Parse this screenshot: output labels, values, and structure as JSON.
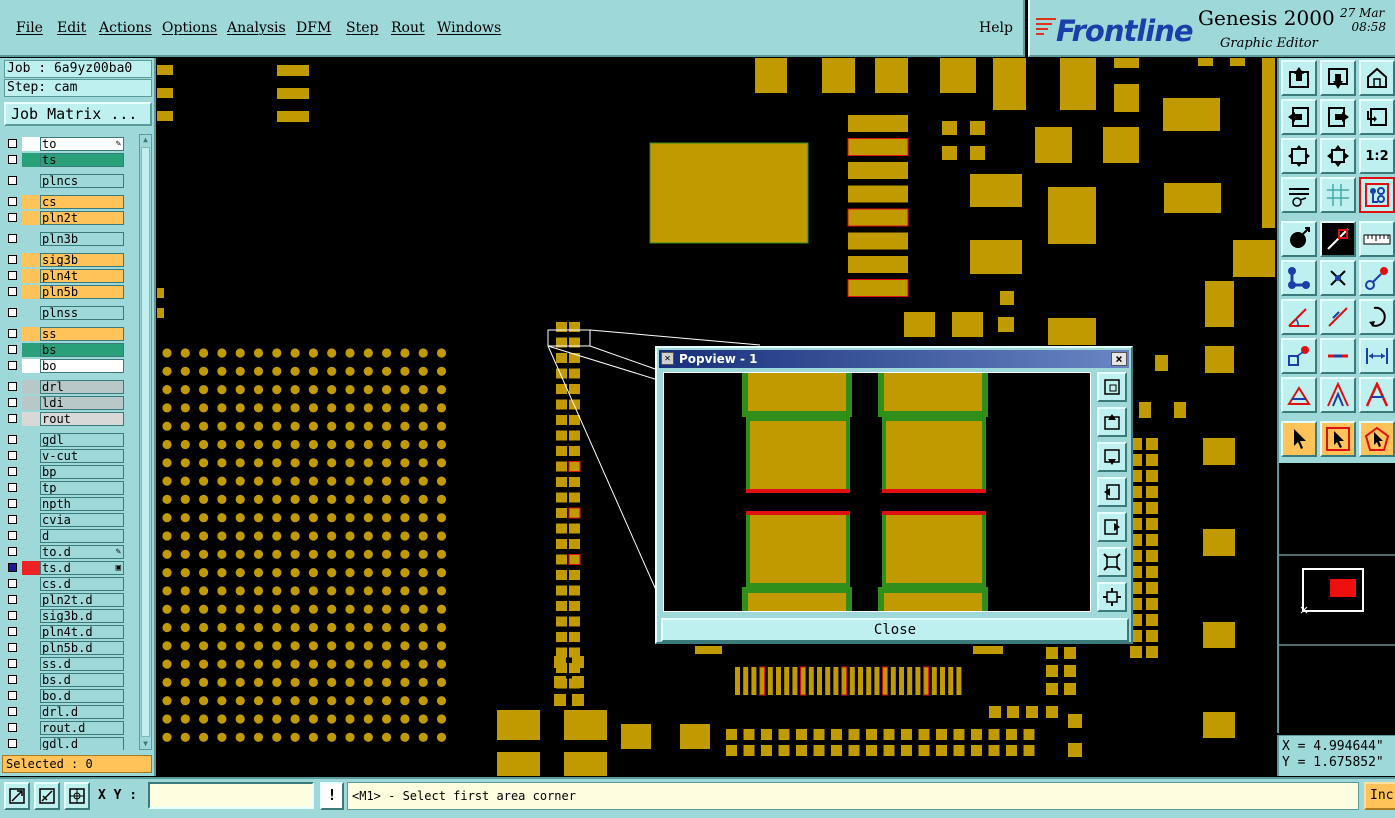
{
  "menubar": {
    "items": [
      "File",
      "Edit",
      "Actions",
      "Options",
      "Analysis",
      "DFM",
      "Step",
      "Rout",
      "Windows"
    ],
    "help": "Help"
  },
  "brand": {
    "logo": "Frontline",
    "product": "Genesis 2000",
    "editor": "Graphic Editor",
    "date_day": "27",
    "date_month": "Mar",
    "time": "08:58"
  },
  "left": {
    "job": "Job : 6a9yz00ba0",
    "step": "Step: cam",
    "job_matrix": "Job Matrix ...",
    "selected": "Selected : 0"
  },
  "layers": [
    {
      "name": "to",
      "bg": "#ffffff",
      "color": "#ffffff",
      "flag": "edit"
    },
    {
      "name": "ts",
      "bg": "#2aa07a",
      "color": "#2aa07a",
      "flag": ""
    },
    {
      "name": "plncs",
      "bg": "#9ed8d8",
      "color": "#9ed8d8",
      "flag": ""
    },
    {
      "name": "cs",
      "bg": "#ffc35a",
      "color": "#ffc35a",
      "flag": ""
    },
    {
      "name": "pln2t",
      "bg": "#ffc35a",
      "color": "#ffc35a",
      "flag": ""
    },
    {
      "name": "pln3b",
      "bg": "#9ed8d8",
      "color": "#9ed8d8",
      "flag": ""
    },
    {
      "name": "sig3b",
      "bg": "#ffc35a",
      "color": "#ffc35a",
      "flag": ""
    },
    {
      "name": "pln4t",
      "bg": "#ffc35a",
      "color": "#ffc35a",
      "flag": ""
    },
    {
      "name": "pln5b",
      "bg": "#ffc35a",
      "color": "#ffc35a",
      "flag": ""
    },
    {
      "name": "plnss",
      "bg": "#9ed8d8",
      "color": "#9ed8d8",
      "flag": ""
    },
    {
      "name": "ss",
      "bg": "#ffc35a",
      "color": "#ffc35a",
      "flag": ""
    },
    {
      "name": "bs",
      "bg": "#2aa07a",
      "color": "#2aa07a",
      "flag": ""
    },
    {
      "name": "bo",
      "bg": "#ffffff",
      "color": "#ffffff",
      "flag": ""
    },
    {
      "name": "drl",
      "bg": "#b8c8c8",
      "color": "#b8c8c8",
      "flag": ""
    },
    {
      "name": "ldi",
      "bg": "#b8c8c8",
      "color": "#b8c8c8",
      "flag": ""
    },
    {
      "name": "rout",
      "bg": "#d8d8d8",
      "color": "#d8d8d8",
      "flag": ""
    },
    {
      "name": "gdl",
      "bg": "#9ed8d8",
      "color": "#9ed8d8",
      "flag": ""
    },
    {
      "name": "v-cut",
      "bg": "#9ed8d8",
      "color": "#9ed8d8",
      "flag": ""
    },
    {
      "name": "bp",
      "bg": "#9ed8d8",
      "color": "#9ed8d8",
      "flag": ""
    },
    {
      "name": "tp",
      "bg": "#9ed8d8",
      "color": "#9ed8d8",
      "flag": ""
    },
    {
      "name": "npth",
      "bg": "#9ed8d8",
      "color": "#9ed8d8",
      "flag": ""
    },
    {
      "name": "cvia",
      "bg": "#9ed8d8",
      "color": "#9ed8d8",
      "flag": ""
    },
    {
      "name": "d",
      "bg": "#9ed8d8",
      "color": "#9ed8d8",
      "flag": ""
    },
    {
      "name": "to.d",
      "bg": "#9ed8d8",
      "color": "#9ed8d8",
      "flag": "edit"
    },
    {
      "name": "ts.d",
      "bg": "#9ed8d8",
      "color": "#ee2222",
      "flag": "box",
      "active": true
    },
    {
      "name": "cs.d",
      "bg": "#9ed8d8",
      "color": "#9ed8d8",
      "flag": ""
    },
    {
      "name": "pln2t.d",
      "bg": "#9ed8d8",
      "color": "#9ed8d8",
      "flag": ""
    },
    {
      "name": "sig3b.d",
      "bg": "#9ed8d8",
      "color": "#9ed8d8",
      "flag": ""
    },
    {
      "name": "pln4t.d",
      "bg": "#9ed8d8",
      "color": "#9ed8d8",
      "flag": ""
    },
    {
      "name": "pln5b.d",
      "bg": "#9ed8d8",
      "color": "#9ed8d8",
      "flag": ""
    },
    {
      "name": "ss.d",
      "bg": "#9ed8d8",
      "color": "#9ed8d8",
      "flag": ""
    },
    {
      "name": "bs.d",
      "bg": "#9ed8d8",
      "color": "#9ed8d8",
      "flag": ""
    },
    {
      "name": "bo.d",
      "bg": "#9ed8d8",
      "color": "#9ed8d8",
      "flag": ""
    },
    {
      "name": "drl.d",
      "bg": "#9ed8d8",
      "color": "#9ed8d8",
      "flag": ""
    },
    {
      "name": "rout.d",
      "bg": "#9ed8d8",
      "color": "#9ed8d8",
      "flag": ""
    },
    {
      "name": "gdl.d",
      "bg": "#9ed8d8",
      "color": "#9ed8d8",
      "flag": ""
    }
  ],
  "popview": {
    "title": "Popview - 1",
    "close": "Close"
  },
  "coords": {
    "x": "X = 4.994644\"",
    "y": "Y = 1.675852\""
  },
  "status": {
    "xy_label": "X Y :",
    "xy_value": "",
    "bang": "!",
    "prompt": "<M1> - Select first area corner",
    "inc": "Inc"
  },
  "colors": {
    "pad": "#c19a00",
    "pad_edge_red": "#e01010",
    "pad_edge_green": "#2f8f1a",
    "panel": "#9ed8d8",
    "highlight": "#ffc35a"
  }
}
